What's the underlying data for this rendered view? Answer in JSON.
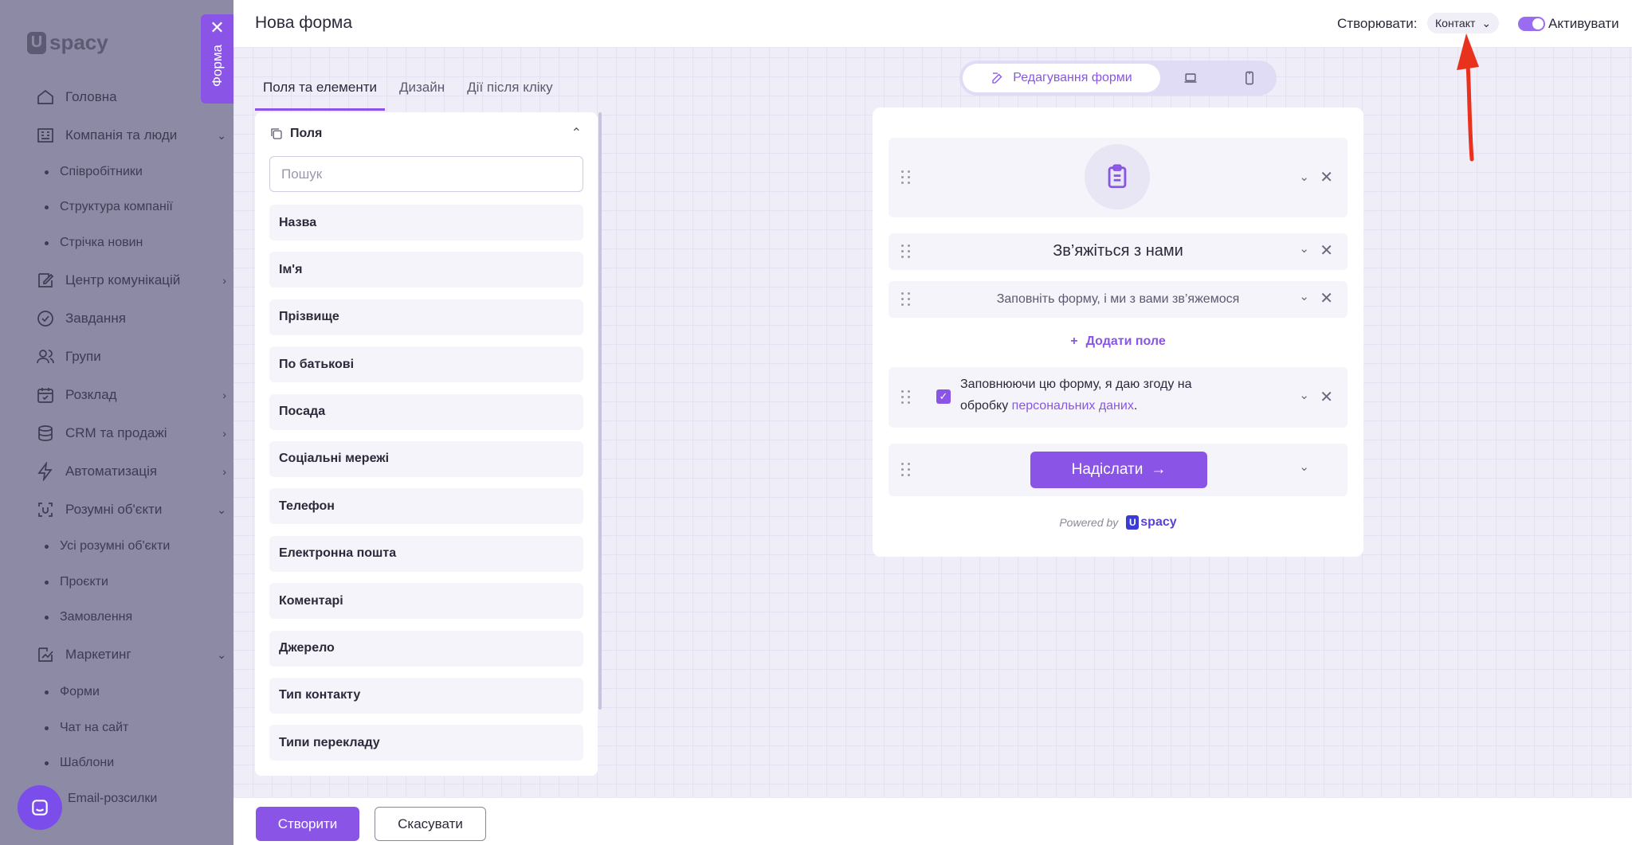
{
  "app": {
    "logo_text": "spacy",
    "logo_initial": "U",
    "nav": [
      {
        "label": "Головна",
        "icon": "home-icon",
        "expand": false
      },
      {
        "label": "Компанія та люди",
        "icon": "building-icon",
        "expand": true
      },
      {
        "label": "Центр комунікацій",
        "icon": "chat-edit-icon",
        "expand": true
      },
      {
        "label": "Завдання",
        "icon": "check-circle-icon",
        "expand": false
      },
      {
        "label": "Групи",
        "icon": "users-icon",
        "expand": false
      },
      {
        "label": "Розклад",
        "icon": "calendar-icon",
        "expand": true
      },
      {
        "label": "CRM та продажі",
        "icon": "database-icon",
        "expand": true
      },
      {
        "label": "Автоматизація",
        "icon": "lightning-icon",
        "expand": true
      },
      {
        "label": "Розумні об'єкти",
        "icon": "smart-object-icon",
        "expand": true
      },
      {
        "label": "Маркетинг",
        "icon": "marketing-icon",
        "expand": true
      }
    ],
    "sub_company": [
      "Співробітники",
      "Структура компанії",
      "Стрічка новин"
    ],
    "sub_smart": [
      "Усі розумні об'єкти",
      "Проєкти",
      "Замовлення"
    ],
    "sub_marketing": [
      "Форми",
      "Чат на сайт",
      "Шаблони",
      "Email-розсилки"
    ]
  },
  "form_tab": {
    "close": "✕",
    "label": "Форма"
  },
  "topbar": {
    "title": "Нова форма",
    "create_label": "Створювати:",
    "create_value": "Контакт",
    "activate_label": "Активувати",
    "activate_on": true
  },
  "tabs": [
    "Поля та елементи",
    "Дизайн",
    "Дії після кліку"
  ],
  "fields": {
    "header": "Поля",
    "search_placeholder": "Пошук",
    "items": [
      "Назва",
      "Ім'я",
      "Прізвище",
      "По батькові",
      "Посада",
      "Соціальні мережі",
      "Телефон",
      "Електронна пошта",
      "Коментарі",
      "Джерело",
      "Тип контакту",
      "Типи перекладу"
    ]
  },
  "bottom": {
    "create": "Створити",
    "cancel": "Скасувати"
  },
  "view_switch": {
    "edit_label": "Редагування форми"
  },
  "preview": {
    "heading": "Зв’яжіться з нами",
    "subtext": "Заповніть форму, і ми з вами зв’яжемося",
    "add_field": "Додати поле",
    "consent_text": "Заповнюючи цю форму, я даю згоду на обробку ",
    "consent_link": "персональних даних",
    "consent_end": ".",
    "submit": "Надіслати",
    "powered_by": "Powered by",
    "brand": "spacy",
    "brand_initial": "U"
  },
  "colors": {
    "accent": "#8a55e6",
    "arrow": "#e8321e"
  }
}
